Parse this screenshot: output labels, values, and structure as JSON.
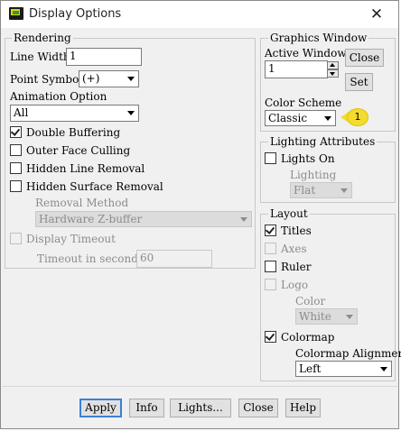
{
  "window": {
    "title": "Display Options",
    "close_glyph": "✕",
    "icon": "display-app-icon"
  },
  "rendering": {
    "group_label": "Rendering",
    "line_width_label": "Line Width",
    "line_width_value": "1",
    "point_symbol_label": "Point Symbol",
    "point_symbol_value": "(+)",
    "animation_option_label": "Animation Option",
    "animation_option_value": "All",
    "double_buffering_label": "Double Buffering",
    "double_buffering_checked": true,
    "outer_face_culling_label": "Outer Face Culling",
    "outer_face_culling_checked": false,
    "hidden_line_removal_label": "Hidden Line Removal",
    "hidden_line_removal_checked": false,
    "hidden_surface_removal_label": "Hidden Surface Removal",
    "hidden_surface_removal_checked": false,
    "removal_method_label": "Removal Method",
    "removal_method_value": "Hardware Z-buffer",
    "display_timeout_label": "Display Timeout",
    "display_timeout_checked": false,
    "timeout_label": "Timeout in seconds",
    "timeout_value": "60"
  },
  "graphics_window": {
    "group_label": "Graphics Window",
    "active_window_label": "Active Window",
    "active_window_value": "1",
    "close_label": "Close",
    "set_label": "Set",
    "color_scheme_label": "Color Scheme",
    "color_scheme_value": "Classic",
    "callout_number": "1"
  },
  "lighting": {
    "group_label": "Lighting Attributes",
    "lights_on_label": "Lights On",
    "lights_on_checked": false,
    "lighting_label": "Lighting",
    "lighting_value": "Flat"
  },
  "layout": {
    "group_label": "Layout",
    "titles_label": "Titles",
    "titles_checked": true,
    "axes_label": "Axes",
    "axes_checked": false,
    "ruler_label": "Ruler",
    "ruler_checked": false,
    "logo_label": "Logo",
    "logo_checked": false,
    "color_label": "Color",
    "color_value": "White",
    "colormap_label": "Colormap",
    "colormap_checked": true,
    "colormap_alignment_label": "Colormap Alignment",
    "colormap_alignment_value": "Left"
  },
  "footer": {
    "apply_label": "Apply",
    "info_label": "Info",
    "lights_label": "Lights...",
    "close_label": "Close",
    "help_label": "Help"
  },
  "colors": {
    "callout": "#f4dc2e",
    "default_button_border": "#3c7fd4",
    "dialog_bg": "#f0f0f0"
  }
}
